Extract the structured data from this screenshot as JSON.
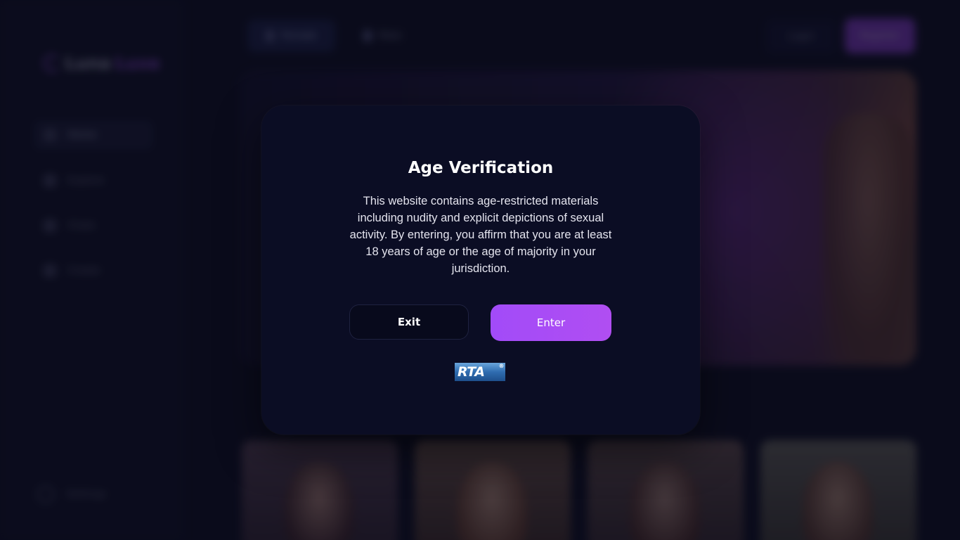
{
  "background_app": {
    "brand": {
      "name_part1": "Luna",
      "name_part2": "Luxe"
    },
    "sidebar_items": [
      {
        "label": "Home",
        "icon": "home-icon",
        "active": true
      },
      {
        "label": "Explore",
        "icon": "grid-icon",
        "active": false
      },
      {
        "label": "Chats",
        "icon": "chat-icon",
        "active": false
      },
      {
        "label": "Create",
        "icon": "plus-icon",
        "active": false
      }
    ],
    "settings_label": "Settings",
    "top_tabs": [
      {
        "label": "Female",
        "active": true
      },
      {
        "label": "Male",
        "active": false
      }
    ],
    "login_label": "Login",
    "register_label": "Register"
  },
  "modal": {
    "title": "Age Verification",
    "body": "This website contains age-restricted materials including nudity and explicit depictions of sexual activity. By entering, you affirm that you are at least 18 years of age or the age of majority in your jurisdiction.",
    "exit_label": "Exit",
    "enter_label": "Enter",
    "rta_logo_text": "RTA",
    "rta_registered": "®"
  },
  "colors": {
    "accent": "#a855f7",
    "modal_bg": "#0b0d24",
    "page_bg": "#0c0e1e"
  }
}
